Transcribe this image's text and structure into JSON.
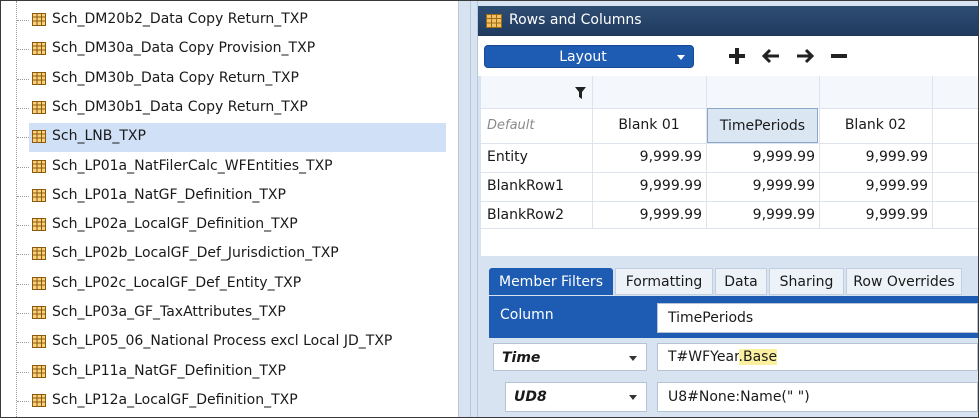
{
  "tree": {
    "items": [
      "Sch_DM20b2_Data Copy Return_TXP",
      "Sch_DM30a_Data Copy Provision_TXP",
      "Sch_DM30b_Data Copy Return_TXP",
      "Sch_DM30b1_Data Copy Return_TXP",
      "Sch_LNB_TXP",
      "Sch_LP01a_NatFilerCalc_WFEntities_TXP",
      "Sch_LP01a_NatGF_Definition_TXP",
      "Sch_LP02a_LocalGF_Definition_TXP",
      "Sch_LP02b_LocalGF_Def_Jurisdiction_TXP",
      "Sch_LP02c_LocalGF_Def_Entity_TXP",
      "Sch_LP03a_GF_TaxAttributes_TXP",
      "Sch_LP05_06_National Process excl Local JD_TXP",
      "Sch_LP11a_NatGF_Definition_TXP",
      "Sch_LP12a_LocalGF_Definition_TXP"
    ],
    "selected_index": 4
  },
  "panel": {
    "title": "Rows and Columns",
    "layout_label": "Layout",
    "header_color": "#1f3a5e",
    "accent": "#1e5cb3"
  },
  "toolbar": {
    "icons": [
      "plus-icon",
      "arrow-left-icon",
      "arrow-right-icon",
      "minus-icon"
    ]
  },
  "grid": {
    "default_label": "Default",
    "columns": [
      "Blank 01",
      "TimePeriods",
      "Blank 02"
    ],
    "selected_column_index": 1,
    "rows": [
      {
        "label": "Entity",
        "values": [
          "9,999.99",
          "9,999.99",
          "9,999.99"
        ]
      },
      {
        "label": "BlankRow1",
        "values": [
          "9,999.99",
          "9,999.99",
          "9,999.99"
        ]
      },
      {
        "label": "BlankRow2",
        "values": [
          "9,999.99",
          "9,999.99",
          "9,999.99"
        ]
      }
    ]
  },
  "tabs": {
    "items": [
      "Member Filters",
      "Formatting",
      "Data",
      "Sharing",
      "Row Overrides"
    ],
    "active_index": 0
  },
  "props": {
    "column_label": "Column",
    "column_value": "TimePeriods",
    "dim1": "Time",
    "dim1_value_prefix": "T#WFYear",
    "dim1_value_highlight": ".Base",
    "dim2": "UD8",
    "dim2_value": "U8#None:Name(\" \")"
  }
}
